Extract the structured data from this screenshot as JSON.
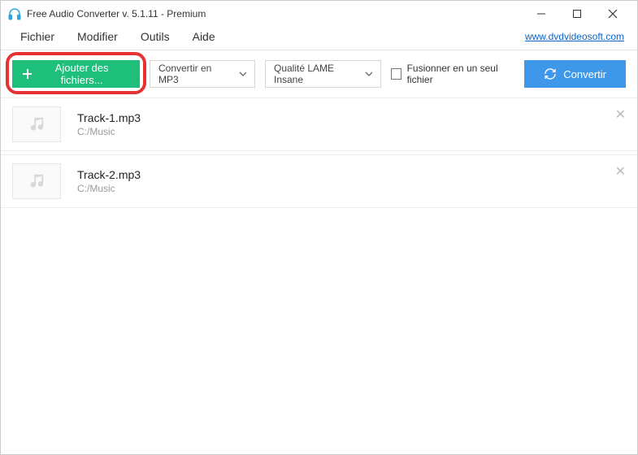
{
  "window": {
    "title": "Free Audio Converter v. 5.1.11 - Premium"
  },
  "menu": {
    "items": [
      "Fichier",
      "Modifier",
      "Outils",
      "Aide"
    ],
    "link": "www.dvdvideosoft.com"
  },
  "toolbar": {
    "add_label": "Ajouter des fichiers...",
    "format_select": "Convertir en MP3",
    "quality_select": "Qualité LAME Insane",
    "merge_label": "Fusionner en un seul fichier",
    "convert_label": "Convertir"
  },
  "tracks": [
    {
      "name": "Track-1.mp3",
      "path": "C:/Music"
    },
    {
      "name": "Track-2.mp3",
      "path": "C:/Music"
    }
  ]
}
